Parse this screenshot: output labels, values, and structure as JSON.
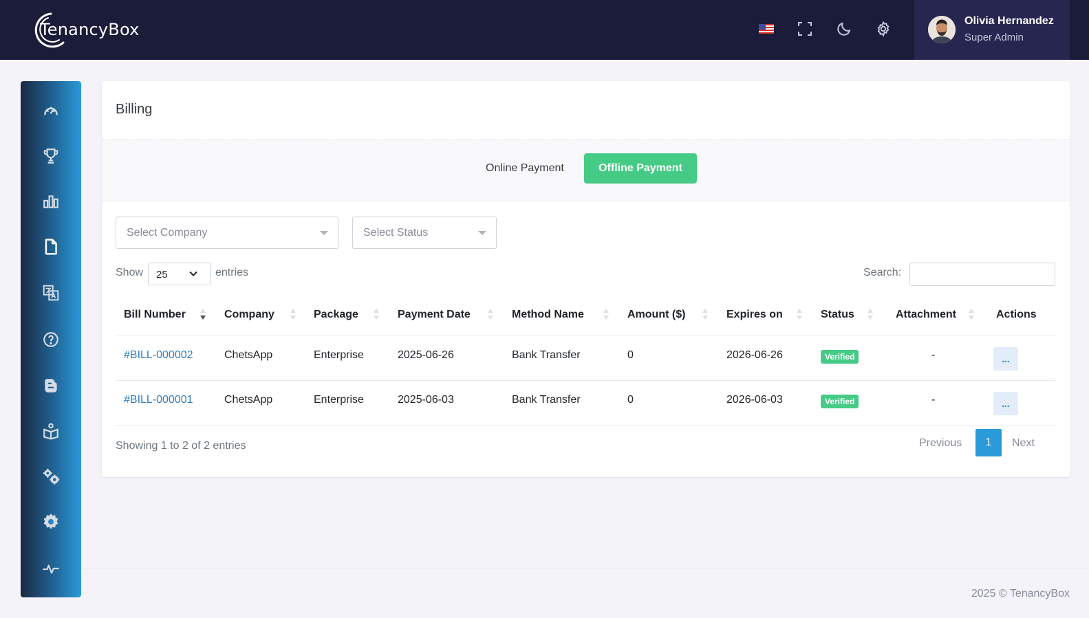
{
  "brand": {
    "name": "TenancyBox"
  },
  "user": {
    "name": "Olivia Hernandez",
    "role": "Super Admin"
  },
  "page": {
    "title": "Billing"
  },
  "tabs": {
    "online": "Online Payment",
    "offline": "Offline Payment",
    "active_color": "#45cb85"
  },
  "filters": {
    "company_placeholder": "Select Company",
    "status_placeholder": "Select Status"
  },
  "length": {
    "show": "Show",
    "value": "25",
    "entries": "entries"
  },
  "search": {
    "label": "Search:"
  },
  "table": {
    "headers": [
      "Bill Number",
      "Company",
      "Package",
      "Payment Date",
      "Method Name",
      "Amount ($)",
      "Expires on",
      "Status",
      "Attachment",
      "Actions"
    ],
    "rows": [
      {
        "bill": "#BILL-000002",
        "company": "ChetsApp",
        "package": "Enterprise",
        "payment_date": "2025-06-26",
        "method": "Bank Transfer",
        "amount": "0",
        "expires": "2026-06-26",
        "status": "Verified",
        "attachment": "-",
        "action": "..."
      },
      {
        "bill": "#BILL-000001",
        "company": "ChetsApp",
        "package": "Enterprise",
        "payment_date": "2025-06-03",
        "method": "Bank Transfer",
        "amount": "0",
        "expires": "2026-06-03",
        "status": "Verified",
        "attachment": "-",
        "action": "..."
      }
    ]
  },
  "info": "Showing 1 to 2 of 2 entries",
  "pagination": {
    "previous": "Previous",
    "current": "1",
    "next": "Next"
  },
  "footer": "2025 © TenancyBox",
  "icons": {
    "topbar": [
      "us-flag-icon",
      "fullscreen-icon",
      "moon-icon",
      "gear-icon"
    ],
    "sidebar": [
      "dashboard-gauge-icon",
      "trophy-icon",
      "bar-chart-icon",
      "file-icon",
      "translate-icon",
      "help-circle-icon",
      "blog-icon",
      "book-reader-icon",
      "cogs-icon",
      "settings-gear-icon",
      "pulse-icon"
    ]
  },
  "colors": {
    "topbar": "#1b1b3a",
    "accent": "#2b9ad8",
    "success": "#45cb85",
    "link": "#2e7fc1"
  }
}
